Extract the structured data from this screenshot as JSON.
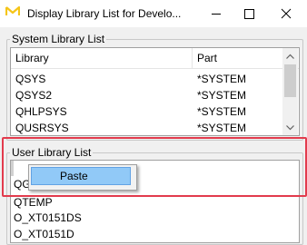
{
  "window": {
    "title": "Display Library List for Develo...",
    "controls": {
      "minimize": "minimize",
      "maximize": "maximize",
      "close": "close"
    }
  },
  "system_list": {
    "label": "System Library List",
    "columns": [
      "Library",
      "Part"
    ],
    "rows": [
      {
        "library": "QSYS",
        "part": "*SYSTEM"
      },
      {
        "library": "QSYS2",
        "part": "*SYSTEM"
      },
      {
        "library": "QHLPSYS",
        "part": "*SYSTEM"
      },
      {
        "library": "QUSRSYS",
        "part": "*SYSTEM"
      }
    ]
  },
  "user_list": {
    "label": "User Library List",
    "rows": [
      "QG",
      "QTEMP",
      "O_XT0151DS",
      "O_XT0151D"
    ]
  },
  "context_menu": {
    "items": [
      "Paste"
    ]
  },
  "colors": {
    "highlight": "#e23b4d",
    "menu_selected": "#91c9f7",
    "app_icon": "#f5c518"
  }
}
